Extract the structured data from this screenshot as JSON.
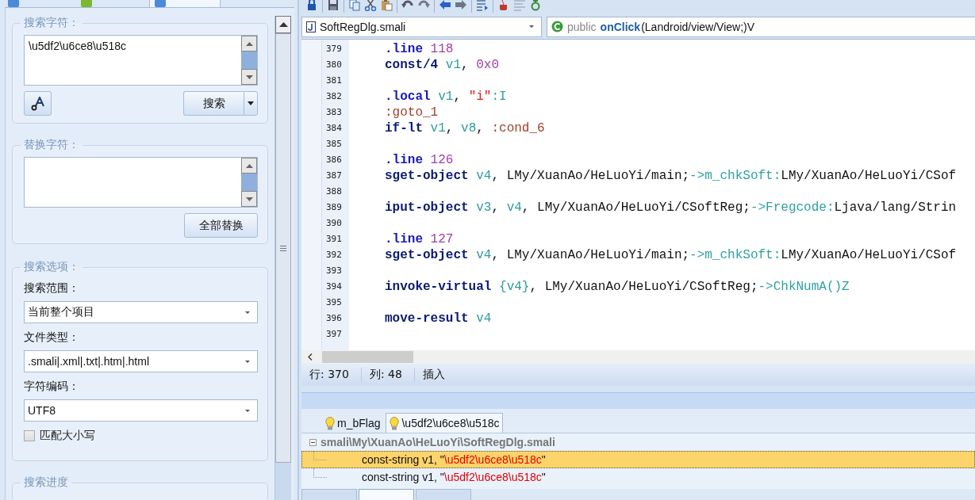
{
  "left_tabs": [
    {
      "selected": false
    },
    {
      "selected": false
    },
    {
      "selected": true
    }
  ],
  "search_group": {
    "title": "搜索字符：",
    "value": "\\u5df2\\u6ce8\\u518c",
    "search_button": "搜索"
  },
  "replace_group": {
    "title": "替换字符：",
    "replace_all_button": "全部替换"
  },
  "options_group": {
    "title": "搜索选项：",
    "fields": [
      {
        "label": "搜索范围：",
        "value": "当前整个项目"
      },
      {
        "label": "文件类型：",
        "value": ".smali|.xml|.txt|.htm|.html"
      },
      {
        "label": "字符编码：",
        "value": "UTF8"
      }
    ],
    "match_case": {
      "label": "匹配大小写",
      "checked": false
    }
  },
  "progress_group": {
    "title": "搜索进度"
  },
  "editor": {
    "file": "SoftRegDlg.smali",
    "method": {
      "modifier": "public",
      "name": "onClick",
      "signature": "(Landroid/view/View;)V"
    },
    "lines": [
      {
        "number": "379",
        "tokens": [
          {
            "kind": "directive",
            "text": ".line"
          },
          {
            "kind": "number",
            "text": " 118"
          }
        ]
      },
      {
        "number": "380",
        "tokens": [
          {
            "kind": "instruction",
            "text": "const/4"
          },
          {
            "kind": "register",
            "text": " v1"
          },
          {
            "kind": "plain",
            "text": ", "
          },
          {
            "kind": "number",
            "text": "0x0"
          }
        ]
      },
      {
        "number": "381"
      },
      {
        "number": "382",
        "tokens": [
          {
            "kind": "directive",
            "text": ".local"
          },
          {
            "kind": "register",
            "text": " v1"
          },
          {
            "kind": "plain",
            "text": ", "
          },
          {
            "kind": "string",
            "text": "\"i\""
          },
          {
            "kind": "reference",
            "text": ":I"
          }
        ]
      },
      {
        "number": "383",
        "tokens": [
          {
            "kind": "label",
            "text": ":goto_1"
          }
        ]
      },
      {
        "number": "384",
        "tokens": [
          {
            "kind": "instruction",
            "text": "if-lt"
          },
          {
            "kind": "register",
            "text": " v1"
          },
          {
            "kind": "plain",
            "text": ", "
          },
          {
            "kind": "register",
            "text": "v8"
          },
          {
            "kind": "plain",
            "text": ", "
          },
          {
            "kind": "label",
            "text": ":cond_6"
          }
        ]
      },
      {
        "number": "385"
      },
      {
        "number": "386",
        "tokens": [
          {
            "kind": "directive",
            "text": ".line"
          },
          {
            "kind": "number",
            "text": " 126"
          }
        ]
      },
      {
        "number": "387",
        "tokens": [
          {
            "kind": "instruction",
            "text": "sget-object"
          },
          {
            "kind": "register",
            "text": " v4"
          },
          {
            "kind": "plain",
            "text": ", LMy/XuanAo/HeLuoYi/main;"
          },
          {
            "kind": "reference",
            "text": "->m_chkSoft:"
          },
          {
            "kind": "plain",
            "text": "LMy/XuanAo/HeLuoYi/CSof"
          }
        ]
      },
      {
        "number": "388"
      },
      {
        "number": "389",
        "tokens": [
          {
            "kind": "instruction",
            "text": "iput-object"
          },
          {
            "kind": "register",
            "text": " v3"
          },
          {
            "kind": "plain",
            "text": ", "
          },
          {
            "kind": "register",
            "text": "v4"
          },
          {
            "kind": "plain",
            "text": ", LMy/XuanAo/HeLuoYi/CSoftReg;"
          },
          {
            "kind": "reference",
            "text": "->Fregcode:"
          },
          {
            "kind": "plain",
            "text": "Ljava/lang/Strin"
          }
        ]
      },
      {
        "number": "390"
      },
      {
        "number": "391",
        "tokens": [
          {
            "kind": "directive",
            "text": ".line"
          },
          {
            "kind": "number",
            "text": " 127"
          }
        ]
      },
      {
        "number": "392",
        "tokens": [
          {
            "kind": "instruction",
            "text": "sget-object"
          },
          {
            "kind": "register",
            "text": " v4"
          },
          {
            "kind": "plain",
            "text": ", LMy/XuanAo/HeLuoYi/main;"
          },
          {
            "kind": "reference",
            "text": "->m_chkSoft:"
          },
          {
            "kind": "plain",
            "text": "LMy/XuanAo/HeLuoYi/CSof"
          }
        ]
      },
      {
        "number": "393"
      },
      {
        "number": "394",
        "tokens": [
          {
            "kind": "instruction",
            "text": "invoke-virtual"
          },
          {
            "kind": "register",
            "text": " {v4}"
          },
          {
            "kind": "plain",
            "text": ", LMy/XuanAo/HeLuoYi/CSoftReg;"
          },
          {
            "kind": "reference",
            "text": "->ChkNumA()Z"
          }
        ]
      },
      {
        "number": "395"
      },
      {
        "number": "396",
        "tokens": [
          {
            "kind": "instruction",
            "text": "move-result"
          },
          {
            "kind": "register",
            "text": " v4"
          }
        ]
      },
      {
        "number": "397"
      }
    ]
  },
  "status_bar": {
    "line": "行: 370",
    "column": "列: 48",
    "mode": "插入"
  },
  "result_tabs": [
    {
      "label": "m_bFlag",
      "selected": false
    },
    {
      "label": "\\u5df2\\u6ce8\\u518c",
      "selected": true
    }
  ],
  "results": {
    "file": "smali\\My\\XuanAo\\HeLuoYi\\SoftRegDlg.smali",
    "expanded": true,
    "children": [
      {
        "prefix": "const-string v1, \"",
        "match": "\\u5df2\\u6ce8\\u518c",
        "suffix": "\"",
        "selected": true
      },
      {
        "prefix": "const-string v1, \"",
        "match": "\\u5df2\\u6ce8\\u518c",
        "suffix": "\"",
        "selected": false
      }
    ]
  },
  "bottom_tabs": [
    {
      "selected": false
    },
    {
      "selected": true
    },
    {
      "selected": false
    }
  ]
}
